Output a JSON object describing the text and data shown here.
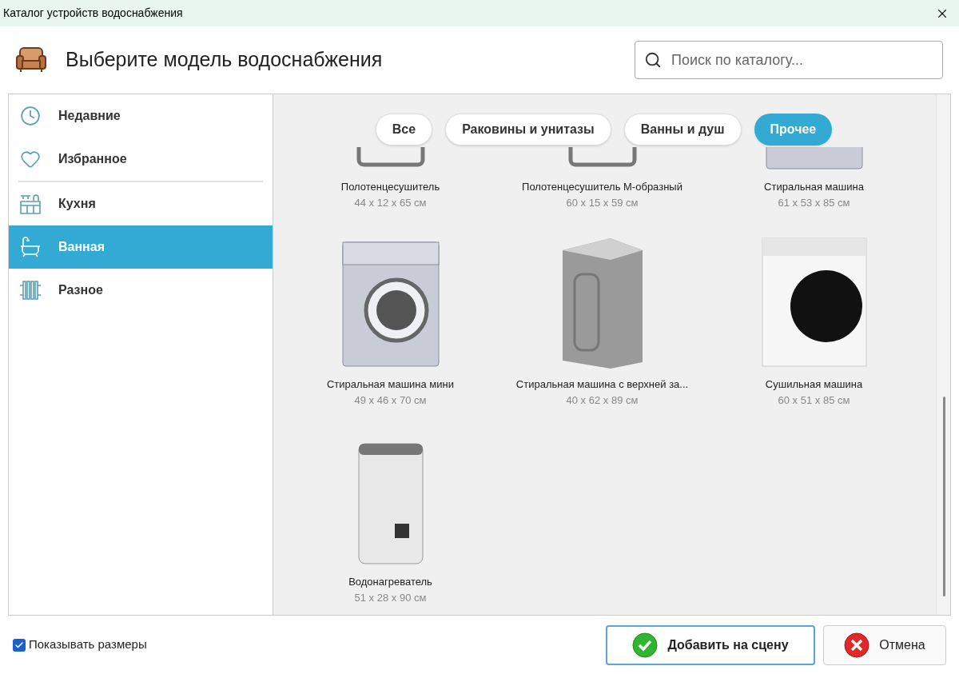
{
  "window": {
    "title": "Каталог устройств водоснабжения"
  },
  "header": {
    "title": "Выберите модель водоснабжения",
    "search": {
      "placeholder": "Поиск по каталогу..."
    }
  },
  "sidebar": {
    "items": [
      {
        "label": "Недавние",
        "kind": "clock",
        "selected": false,
        "separator_after": false
      },
      {
        "label": "Избранное",
        "kind": "heart",
        "selected": false,
        "separator_after": true
      },
      {
        "label": "Кухня",
        "kind": "kitchen",
        "selected": false,
        "separator_after": false
      },
      {
        "label": "Ванная",
        "kind": "bath",
        "selected": true,
        "separator_after": false
      },
      {
        "label": "Разное",
        "kind": "radiator",
        "selected": false,
        "separator_after": false
      }
    ]
  },
  "filters": [
    {
      "label": "Все",
      "selected": false
    },
    {
      "label": "Раковины и унитазы",
      "selected": false
    },
    {
      "label": "Ванны и душ",
      "selected": false
    },
    {
      "label": "Прочее",
      "selected": true
    }
  ],
  "items": [
    {
      "name": "Полотенцесушитель",
      "size": "44 x 12 x 65 см",
      "kind": "rail"
    },
    {
      "name": "Полотенцесушитель М-образный",
      "size": "60 x 15 x 59 см",
      "kind": "rail"
    },
    {
      "name": "Стиральная машина",
      "size": "61 x 53 x 85 см",
      "kind": "washer"
    },
    {
      "name": "Стиральная машина мини",
      "size": "49 x 46 x 70 см",
      "kind": "washer"
    },
    {
      "name": "Стиральная машина с верхней за...",
      "size": "40 x 62 x 89 см",
      "kind": "toploader"
    },
    {
      "name": "Сушильная машина",
      "size": "60 x 51 x 85 см",
      "kind": "dryer"
    },
    {
      "name": "Водонагреватель",
      "size": "51 x 28 x 90 см",
      "kind": "heater"
    }
  ],
  "footer": {
    "show_sizes": {
      "label": "Показывать размеры",
      "checked": true
    },
    "buttons": [
      {
        "label": "Добавить на сцену",
        "kind": "ok"
      },
      {
        "label": "Отмена",
        "kind": "cancel"
      }
    ]
  }
}
